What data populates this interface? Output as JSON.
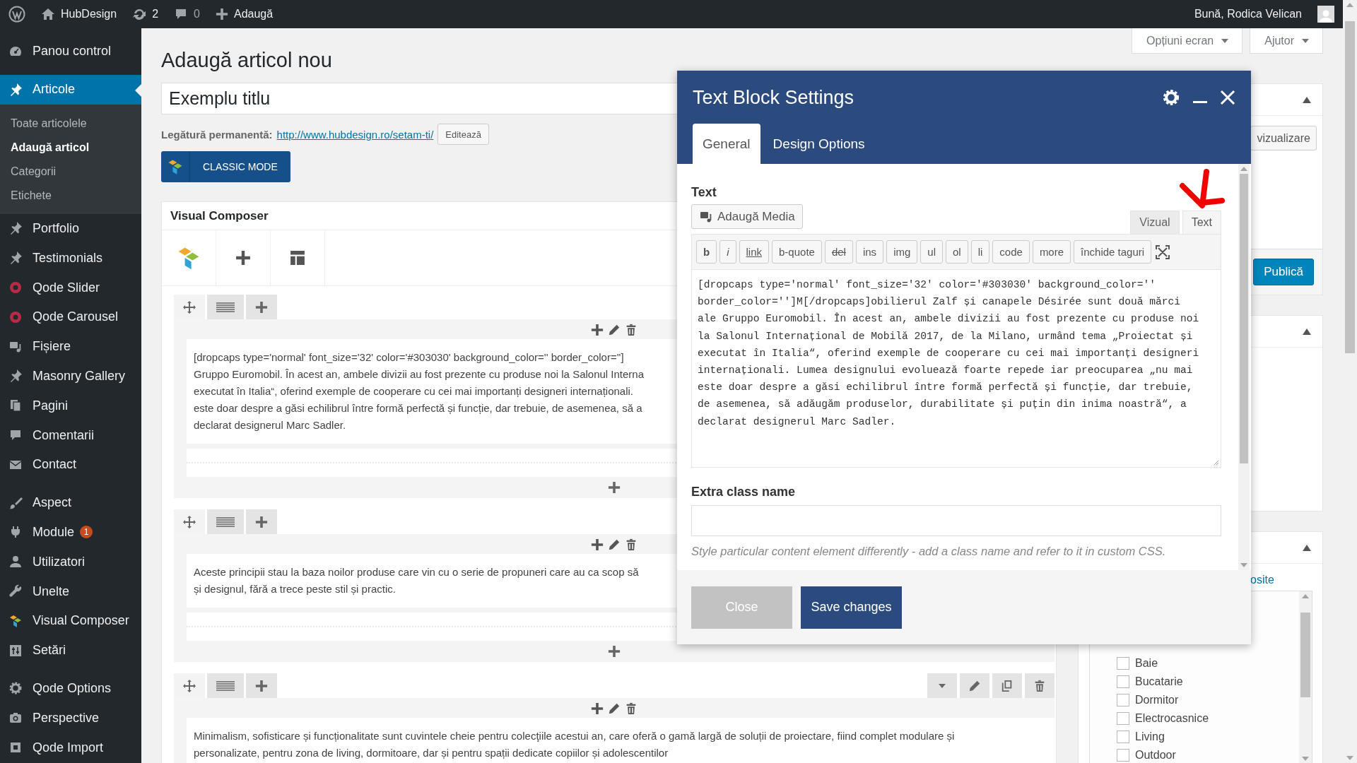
{
  "admin_bar": {
    "site": "HubDesign",
    "updates": "2",
    "comments": "0",
    "new": "Adaugă",
    "greeting": "Bună, Rodica Velican"
  },
  "sidebar": {
    "groups": [
      {
        "items": [
          {
            "label": "Panou control",
            "selected": false
          }
        ]
      },
      {
        "items": [
          {
            "label": "Articole",
            "selected": true,
            "children": [
              {
                "label": "Toate articolele",
                "selected": false
              },
              {
                "label": "Adaugă articol",
                "selected": true
              },
              {
                "label": "Categorii",
                "selected": false
              },
              {
                "label": "Etichete",
                "selected": false
              }
            ]
          },
          {
            "label": "Portfolio",
            "selected": false
          },
          {
            "label": "Testimonials",
            "selected": false
          },
          {
            "label": "Qode Slider",
            "selected": false
          },
          {
            "label": "Qode Carousel",
            "selected": false
          },
          {
            "label": "Fișiere",
            "selected": false
          },
          {
            "label": "Masonry Gallery",
            "selected": false
          },
          {
            "label": "Pagini",
            "selected": false
          },
          {
            "label": "Comentarii",
            "selected": false
          },
          {
            "label": "Contact",
            "selected": false
          }
        ]
      },
      {
        "items": [
          {
            "label": "Aspect",
            "selected": false
          },
          {
            "label": "Module",
            "selected": false,
            "badge": "1"
          },
          {
            "label": "Utilizatori",
            "selected": false
          },
          {
            "label": "Unelte",
            "selected": false
          },
          {
            "label": "Visual Composer",
            "selected": false
          },
          {
            "label": "Setări",
            "selected": false
          }
        ]
      },
      {
        "items": [
          {
            "label": "Qode Options",
            "selected": false
          },
          {
            "label": "Perspective",
            "selected": false
          },
          {
            "label": "Qode Import",
            "selected": false
          }
        ]
      }
    ]
  },
  "screen_buttons": [
    "Opțiuni ecran",
    "Ajutor"
  ],
  "page_title": "Adaugă articol nou",
  "post_title": {
    "value": "Exemplu titlu"
  },
  "permalink": {
    "label": "Legătură permanentă:",
    "url": "http://www.hubdesign.ro/setam-ti/",
    "edit": "Editează"
  },
  "classic_mode": "CLASSIC MODE",
  "composer": {
    "title": "Visual Composer",
    "rows": [
      {
        "lines": [
          "[dropcaps type='normal' font_size='32' color='#303030' background_color='' border_color='']",
          "Gruppo Euromobil. În acest an, ambele divizii au fost prezente cu produse noi la Salonul Interna",
          "executat în Italia“, oferind exemple de cooperare cu cei mai importanți designeri internaționali.",
          "este doar despre a găsi echilibrul între formă perfectă și funcție, dar trebuie, de asemenea, să a",
          "declarat designerul Marc Sadler."
        ]
      },
      {
        "lines": [
          "Aceste principii stau la baza noilor produse care vin cu o serie de propuneri care au ca scop să",
          "și designul, fără a trece peste stil și practic."
        ]
      },
      {
        "row_tools": true,
        "lines": [
          "Minimalism, sofisticare și funcționalitate sunt cuvintele cheie pentru colecţiile acestui an, care oferă o gamă largă de soluții de proiectare, fiind complet modulare și",
          "personalizate, pentru zona de living, dormitoare, dar și pentru spații dedicate copiilor și adolescentilor"
        ]
      }
    ]
  },
  "side_panel": {
    "preview": "vizualizare",
    "publish": "Publică",
    "link": "osite",
    "categories": [
      {
        "label": "Baie",
        "checked": false
      },
      {
        "label": "Bucatarie",
        "checked": false
      },
      {
        "label": "Dormitor",
        "checked": false
      },
      {
        "label": "Electrocasnice",
        "checked": false
      },
      {
        "label": "Living",
        "checked": false
      },
      {
        "label": "Outdoor",
        "checked": false
      }
    ]
  },
  "modal": {
    "title": "Text Block Settings",
    "tabs": [
      {
        "label": "General",
        "selected": true
      },
      {
        "label": "Design Options",
        "selected": false
      }
    ],
    "text_label": "Text",
    "add_media": "Adaugă Media",
    "editor_tabs": [
      {
        "label": "Vizual",
        "selected": false
      },
      {
        "label": "Text",
        "selected": true
      }
    ],
    "quicktags": [
      {
        "label": "b",
        "kind": "bold"
      },
      {
        "label": "i",
        "kind": "italic"
      },
      {
        "label": "link",
        "kind": "link"
      },
      {
        "label": "b-quote",
        "kind": "plain"
      },
      {
        "label": "del",
        "kind": "strike"
      },
      {
        "label": "ins",
        "kind": "plain"
      },
      {
        "label": "img",
        "kind": "plain"
      },
      {
        "label": "ul",
        "kind": "plain"
      },
      {
        "label": "ol",
        "kind": "plain"
      },
      {
        "label": "li",
        "kind": "plain"
      },
      {
        "label": "code",
        "kind": "plain"
      },
      {
        "label": "more",
        "kind": "plain"
      },
      {
        "label": "închide taguri",
        "kind": "plain"
      }
    ],
    "content": "[dropcaps type='normal' font_size='32' color='#303030' background_color='' border_color='']M[/dropcaps]obilierul Zalf și canapele Désirée sunt două mărci ale Gruppo Euromobil. În acest an, ambele divizii au fost prezente cu produse noi la Salonul Internațional de Mobilă 2017, de la Milano, urmând tema „Proiectat și executat în Italia“, oferind exemple de cooperare cu cei mai importanți designeri internaționali. Lumea designului evoluează foarte repede iar preocuparea „nu mai este doar despre a găsi echilibrul între formă perfectă și funcție, dar trebuie, de asemenea, să adăugăm produselor, durabilitate și puțin din inima noastră“, a declarat designerul Marc Sadler.",
    "extra_label": "Extra class name",
    "help": "Style particular content element differently - add a class name and refer to it in custom CSS.",
    "buttons": [
      {
        "label": "Close",
        "kind": "secondary"
      },
      {
        "label": "Save changes",
        "kind": "primary"
      }
    ]
  }
}
